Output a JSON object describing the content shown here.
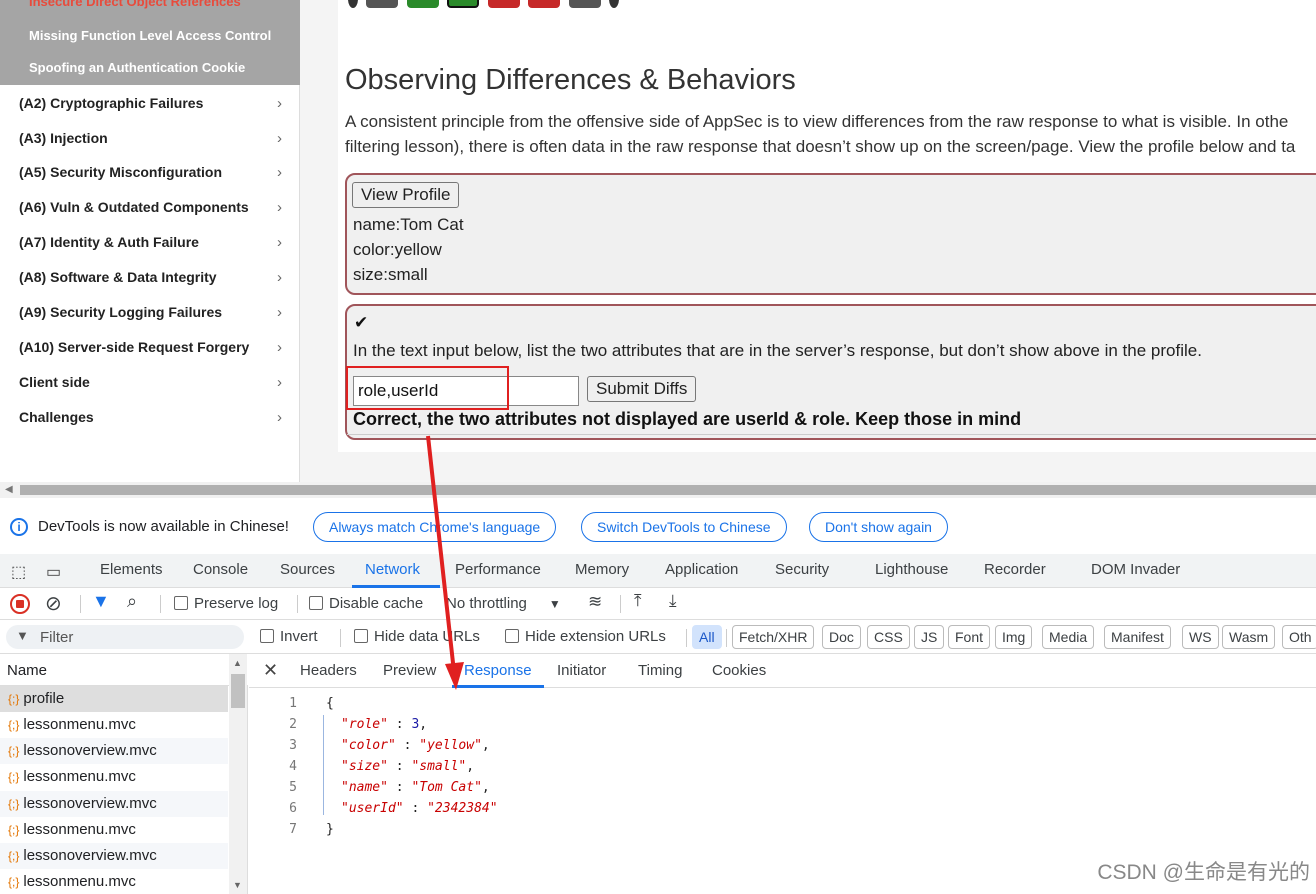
{
  "sidebar": {
    "subitems": [
      {
        "label": "Insecure Direct Object References",
        "active": true
      },
      {
        "label": "Missing Function Level Access Control",
        "active": false
      },
      {
        "label": "Spoofing an Authentication Cookie",
        "active": false
      }
    ],
    "categories": [
      {
        "label": "(A2) Cryptographic Failures"
      },
      {
        "label": "(A3) Injection"
      },
      {
        "label": "(A5) Security Misconfiguration"
      },
      {
        "label": "(A6) Vuln & Outdated Components"
      },
      {
        "label": "(A7) Identity & Auth Failure"
      },
      {
        "label": "(A8) Software & Data Integrity"
      },
      {
        "label": "(A9) Security Logging Failures"
      },
      {
        "label": "(A10) Server-side Request Forgery"
      },
      {
        "label": "Client side"
      },
      {
        "label": "Challenges"
      }
    ],
    "chevron": "›"
  },
  "lesson": {
    "title": "Observing Differences & Behaviors",
    "para_line1": "A consistent principle from the offensive side of AppSec is to view differences from the raw response to what is visible. In othe",
    "para_line2": "filtering lesson), there is often data in the raw response that doesn’t show up on the screen/page. View the profile below and ta",
    "view_profile_button": "View Profile",
    "profile": [
      "name:Tom Cat",
      "color:yellow",
      "size:small"
    ],
    "check_mark": "✔",
    "instruction": "In the text input below, list the two attributes that are in the server’s response, but don’t show above in the profile.",
    "diff_input_value": "role,userId",
    "submit_button": "Submit Diffs",
    "feedback": "Correct, the two attributes not displayed are userId & role. Keep those in mind"
  },
  "devtools": {
    "infobar": {
      "message": "DevTools is now available in Chinese!",
      "match_button": "Always match Chrome's language",
      "switch_button": "Switch DevTools to Chinese",
      "dismiss_button": "Don't show again"
    },
    "tabs": [
      "Elements",
      "Console",
      "Sources",
      "Network",
      "Performance",
      "Memory",
      "Application",
      "Security",
      "Lighthouse",
      "Recorder",
      "DOM Invader"
    ],
    "active_tab": "Network",
    "network_toolbar": {
      "preserve_log": "Preserve log",
      "disable_cache": "Disable cache",
      "throttling": "No throttling"
    },
    "filter_bar": {
      "placeholder": "Filter",
      "invert": "Invert",
      "hide_data_urls": "Hide data URLs",
      "hide_extension_urls": "Hide extension URLs",
      "chips": [
        "All",
        "Fetch/XHR",
        "Doc",
        "CSS",
        "JS",
        "Font",
        "Img",
        "Media",
        "Manifest",
        "WS",
        "Wasm",
        "Oth"
      ]
    },
    "request_list": {
      "header": "Name",
      "items": [
        "profile",
        "lessonmenu.mvc",
        "lessonoverview.mvc",
        "lessonmenu.mvc",
        "lessonoverview.mvc",
        "lessonmenu.mvc",
        "lessonoverview.mvc",
        "lessonmenu.mvc"
      ]
    },
    "detail_tabs": [
      "Headers",
      "Preview",
      "Response",
      "Initiator",
      "Timing",
      "Cookies"
    ],
    "active_detail_tab": "Response",
    "response_lines": [
      {
        "n": "1",
        "text": "{"
      },
      {
        "n": "2",
        "key": "\"role\"",
        "sep": " : ",
        "val": "3",
        "type": "num",
        "end": ","
      },
      {
        "n": "3",
        "key": "\"color\"",
        "sep": " : ",
        "val": "\"yellow\"",
        "type": "str",
        "end": ","
      },
      {
        "n": "4",
        "key": "\"size\"",
        "sep": " : ",
        "val": "\"small\"",
        "type": "str",
        "end": ","
      },
      {
        "n": "5",
        "key": "\"name\"",
        "sep": " : ",
        "val": "\"Tom Cat\"",
        "type": "str",
        "end": ","
      },
      {
        "n": "6",
        "key": "\"userId\"",
        "sep": " : ",
        "val": "\"2342384\"",
        "type": "str",
        "end": ""
      },
      {
        "n": "7",
        "text": "}"
      }
    ]
  },
  "watermark": "CSDN @生命是有光的",
  "colors": {
    "accent": "#1a73e8",
    "lesson_border": "#a0555a",
    "annotation_red": "#e02020",
    "sidebar_active": "#e84b3c"
  }
}
